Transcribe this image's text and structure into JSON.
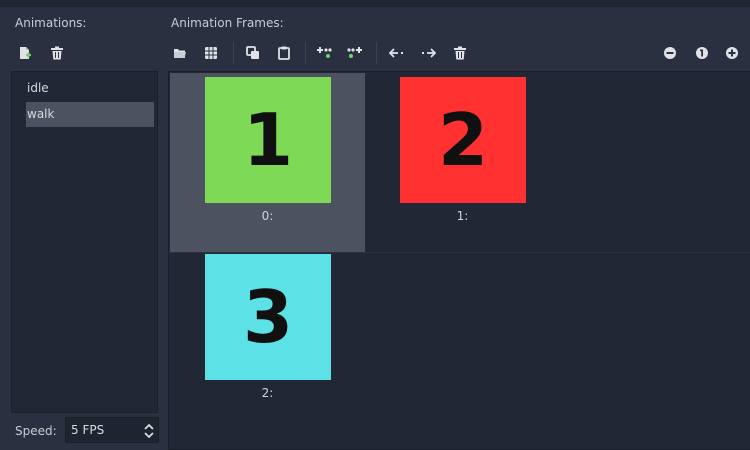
{
  "animations": {
    "label": "Animations:",
    "items": [
      {
        "label": "idle",
        "selected": false
      },
      {
        "label": "walk",
        "selected": true
      }
    ],
    "toolbar": {
      "new_icon": "new-animation-icon",
      "delete_icon": "trash-icon"
    }
  },
  "frames": {
    "label": "Animation Frames:",
    "toolbar": [
      "open-icon",
      "grid-icon",
      "copy-icon",
      "paste-icon",
      "insert-before-icon",
      "insert-after-icon",
      "move-left-icon",
      "move-right-icon",
      "trash-icon"
    ],
    "zoom_toolbar": [
      "zoom-out-icon",
      "zoom-reset-icon",
      "zoom-in-icon"
    ],
    "items": [
      {
        "caption": "0:",
        "number": "1",
        "color": "#7ed957",
        "selected": true
      },
      {
        "caption": "1:",
        "number": "2",
        "color": "#ff3131",
        "selected": false
      },
      {
        "caption": "2:",
        "number": "3",
        "color": "#5ce1e6",
        "selected": false
      }
    ]
  },
  "speed": {
    "label": "Speed:",
    "value": "5 FPS"
  }
}
